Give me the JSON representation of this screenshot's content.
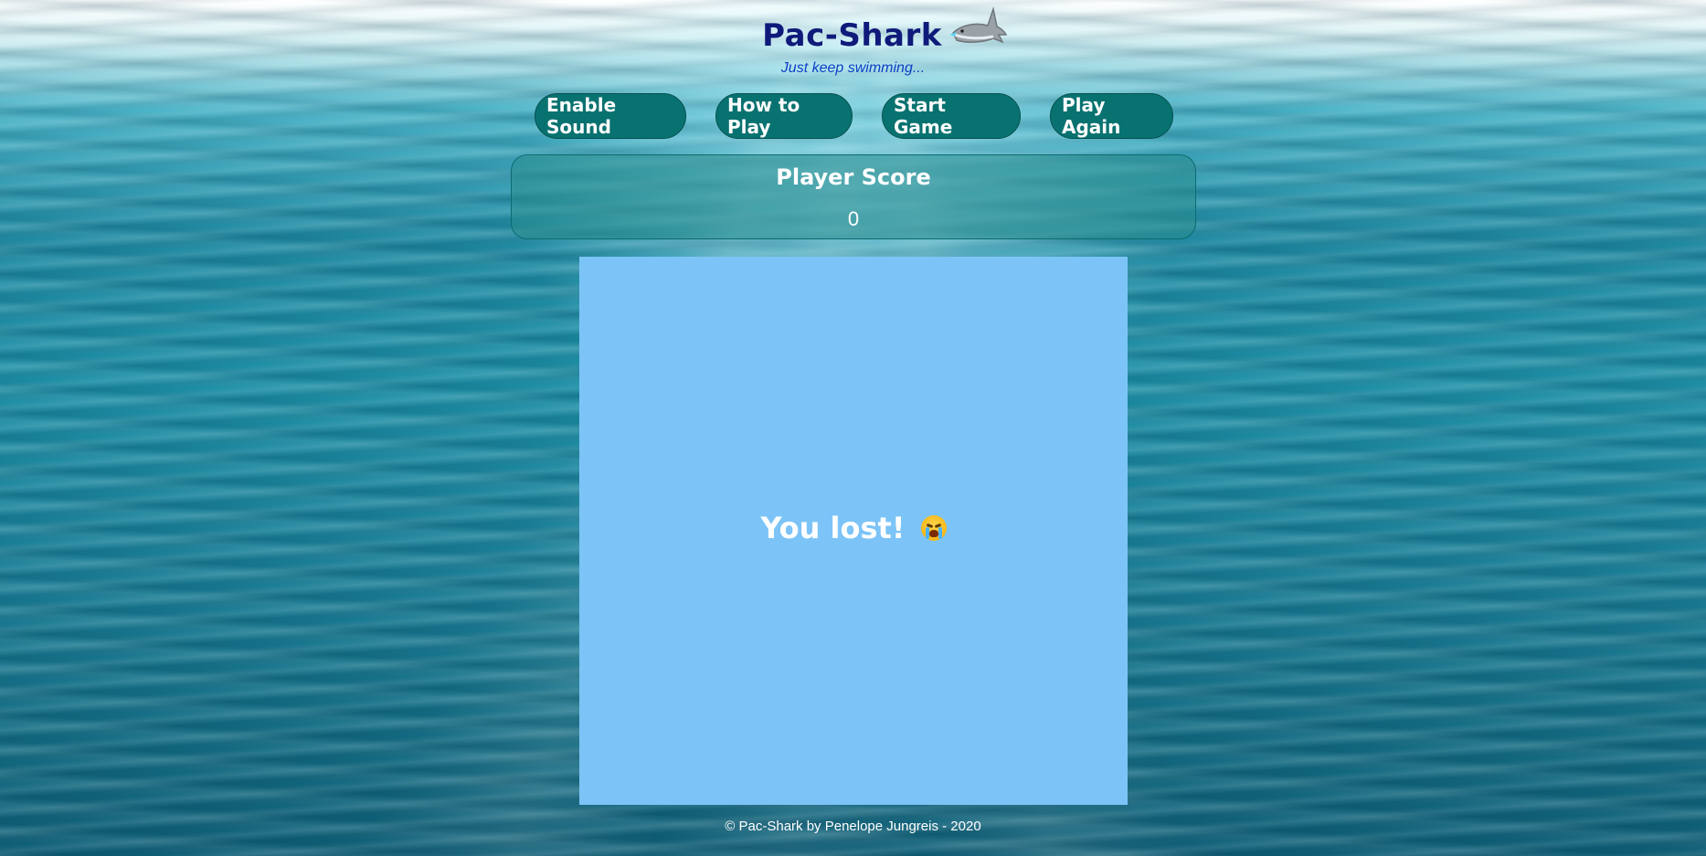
{
  "header": {
    "title": "Pac-Shark",
    "tagline": "Just keep swimming...",
    "logo_icon": "shark-icon"
  },
  "controls": {
    "enable_sound": "Enable Sound",
    "how_to_play": "How to Play",
    "start_game": "Start Game",
    "play_again": "Play Again"
  },
  "score": {
    "label": "Player Score",
    "value": "0"
  },
  "board": {
    "message": "You lost!",
    "message_icon": "crying-face-icon",
    "background_color": "#7cc4f7"
  },
  "footer": {
    "text": "© Pac-Shark by Penelope Jungreis - 2020"
  },
  "colors": {
    "button_bg": "#087270",
    "title": "#0f1a7a",
    "tagline": "#0b3fc4"
  }
}
